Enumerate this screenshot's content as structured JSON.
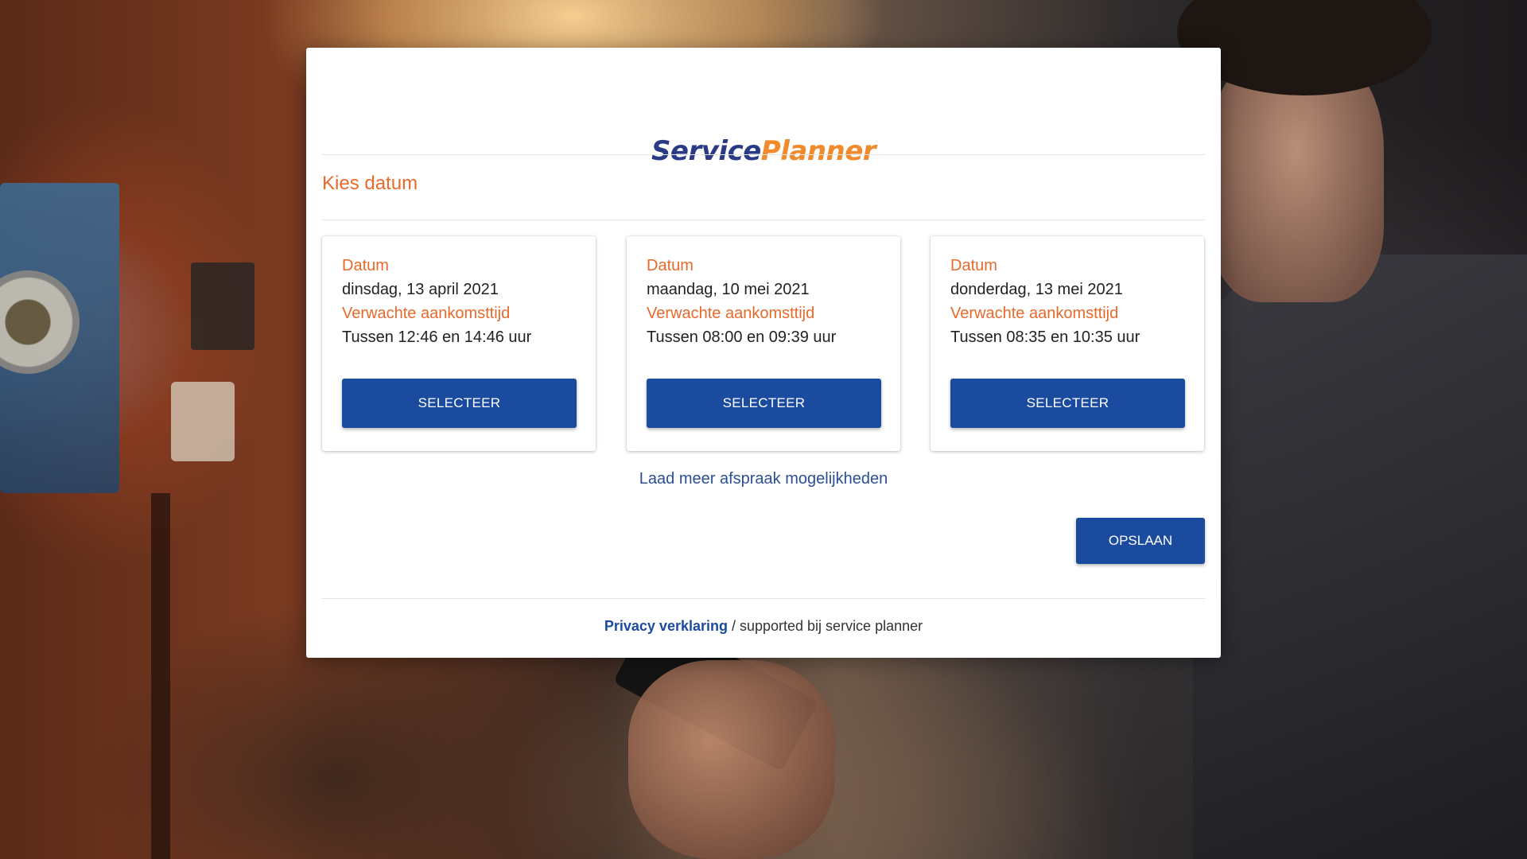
{
  "logo": {
    "part1": "Service",
    "part2": "Planner"
  },
  "section_title": "Kies datum",
  "cards": [
    {
      "date_label": "Datum",
      "date": "dinsdag, 13 april 2021",
      "time_label": "Verwachte aankomsttijd",
      "time": "Tussen 12:46 en 14:46 uur",
      "button": "SELECTEER"
    },
    {
      "date_label": "Datum",
      "date": "maandag, 10 mei 2021",
      "time_label": "Verwachte aankomsttijd",
      "time": "Tussen 08:00 en 09:39 uur",
      "button": "SELECTEER"
    },
    {
      "date_label": "Datum",
      "date": "donderdag, 13 mei 2021",
      "time_label": "Verwachte aankomsttijd",
      "time": "Tussen 08:35 en 10:35 uur",
      "button": "SELECTEER"
    }
  ],
  "load_more": "Laad meer afspraak mogelijkheden",
  "save_button": "OPSLAAN",
  "footer": {
    "privacy": "Privacy verklaring",
    "suffix": " / supported bij service planner"
  },
  "colors": {
    "accent": "#e8692a",
    "primary": "#1a4b9e",
    "logo_blue": "#2a3a85",
    "logo_orange": "#f08a2a"
  }
}
